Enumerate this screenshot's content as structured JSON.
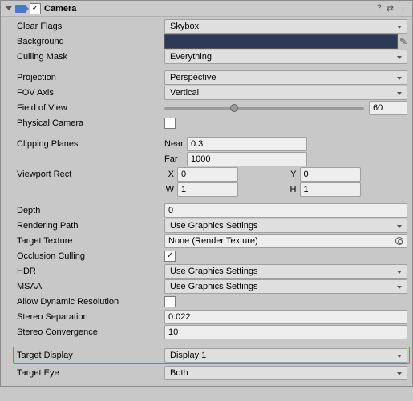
{
  "header": {
    "title": "Camera",
    "enabled_check": "✓"
  },
  "clearFlags": {
    "label": "Clear Flags",
    "value": "Skybox"
  },
  "background": {
    "label": "Background",
    "color": "#2d3a57"
  },
  "cullingMask": {
    "label": "Culling Mask",
    "value": "Everything"
  },
  "projection": {
    "label": "Projection",
    "value": "Perspective"
  },
  "fovAxis": {
    "label": "FOV Axis",
    "value": "Vertical"
  },
  "fov": {
    "label": "Field of View",
    "value": "60"
  },
  "physCam": {
    "label": "Physical Camera",
    "checked": ""
  },
  "clipping": {
    "label": "Clipping Planes",
    "nearLabel": "Near",
    "near": "0.3",
    "farLabel": "Far",
    "far": "1000"
  },
  "viewport": {
    "label": "Viewport Rect",
    "xL": "X",
    "x": "0",
    "yL": "Y",
    "y": "0",
    "wL": "W",
    "w": "1",
    "hL": "H",
    "h": "1"
  },
  "depth": {
    "label": "Depth",
    "value": "0"
  },
  "renderPath": {
    "label": "Rendering Path",
    "value": "Use Graphics Settings"
  },
  "targetTex": {
    "label": "Target Texture",
    "value": "None (Render Texture)"
  },
  "occlusion": {
    "label": "Occlusion Culling",
    "checked": "✓"
  },
  "hdr": {
    "label": "HDR",
    "value": "Use Graphics Settings"
  },
  "msaa": {
    "label": "MSAA",
    "value": "Use Graphics Settings"
  },
  "dynres": {
    "label": "Allow Dynamic Resolution",
    "checked": ""
  },
  "stereoSep": {
    "label": "Stereo Separation",
    "value": "0.022"
  },
  "stereoConv": {
    "label": "Stereo Convergence",
    "value": "10"
  },
  "targetDisplay": {
    "label": "Target Display",
    "value": "Display 1"
  },
  "targetEye": {
    "label": "Target Eye",
    "value": "Both"
  }
}
